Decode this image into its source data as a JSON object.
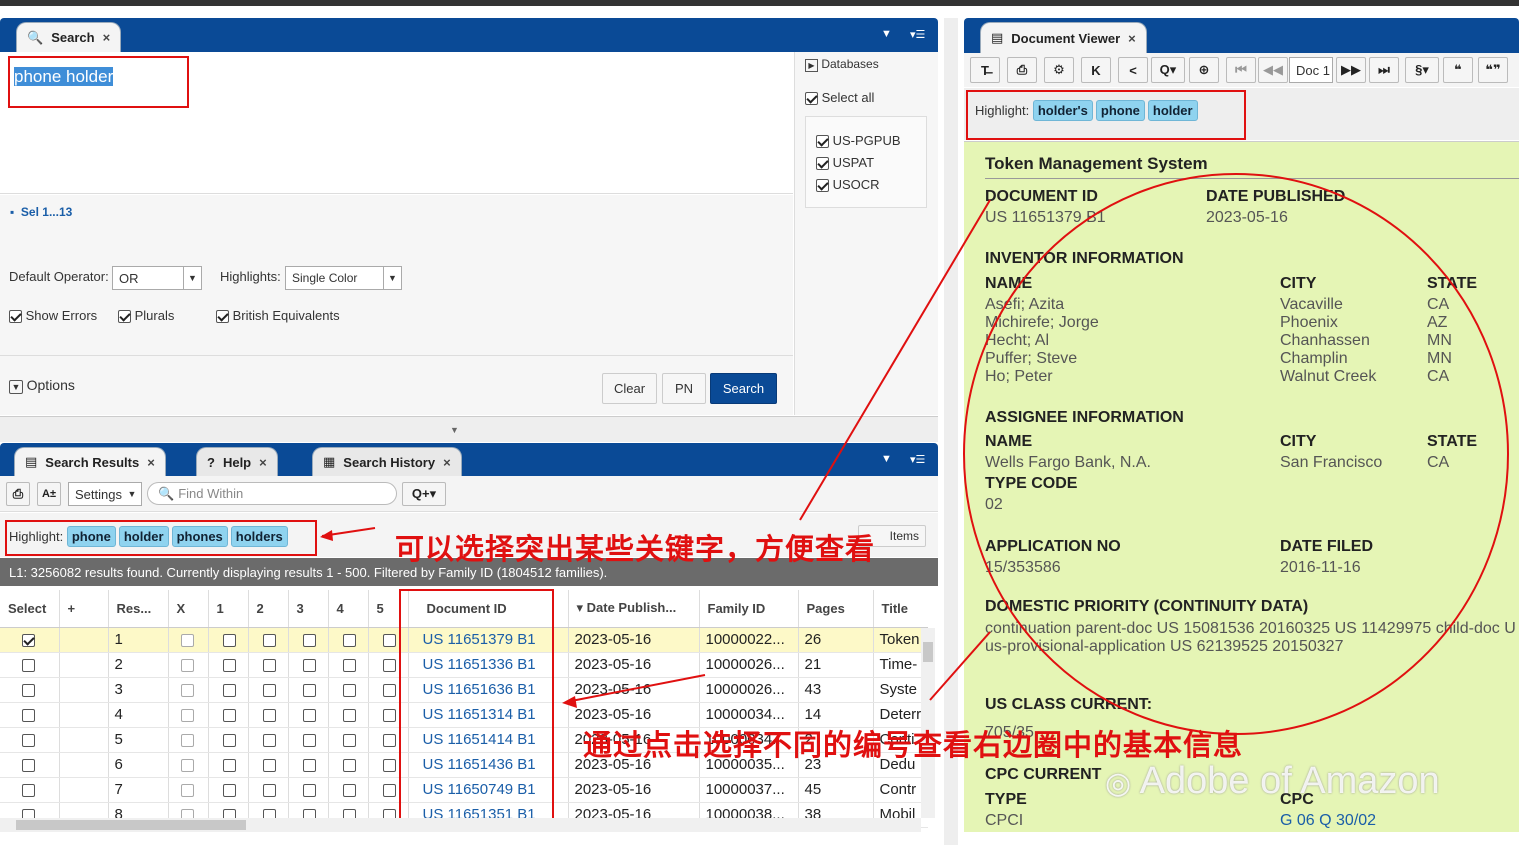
{
  "search_panel": {
    "tab_label": "Search",
    "query": "phone holder",
    "sel_link": "Sel 1...13",
    "default_operator_label": "Default Operator:",
    "default_operator_value": "OR",
    "highlights_label": "Highlights:",
    "highlights_value": "Single Color",
    "show_errors": "Show Errors",
    "plurals": "Plurals",
    "british": "British Equivalents",
    "options": "Options",
    "clear": "Clear",
    "pn": "PN",
    "search": "Search"
  },
  "databases": {
    "title": "Databases",
    "select_all": "Select all",
    "items": [
      "US-PGPUB",
      "USPAT",
      "USOCR"
    ]
  },
  "results_panel": {
    "tabs": [
      "Search Results",
      "Help",
      "Search History"
    ],
    "settings": "Settings",
    "find_within_placeholder": "Find Within",
    "highlight_label": "Highlight:",
    "highlights": [
      "phone",
      "holder",
      "phones",
      "holders"
    ],
    "items_label": "Items",
    "status": "L1: 3256082 results found. Currently displaying results 1 - 500. Filtered by Family ID (1804512 families).",
    "columns": [
      "Select",
      "+",
      "Res...",
      "X",
      "1",
      "2",
      "3",
      "4",
      "5",
      "Document ID",
      "Date Publish...",
      "Family ID",
      "Pages",
      "Title"
    ],
    "rows": [
      {
        "n": "1",
        "doc": "US 11651379 B1",
        "date": "2023-05-16",
        "fam": "10000022...",
        "pages": "26",
        "title": "Token",
        "checked": true
      },
      {
        "n": "2",
        "doc": "US 11651336 B1",
        "date": "2023-05-16",
        "fam": "10000026...",
        "pages": "21",
        "title": "Time-"
      },
      {
        "n": "3",
        "doc": "US 11651636 B1",
        "date": "2023-05-16",
        "fam": "10000026...",
        "pages": "43",
        "title": "Syste"
      },
      {
        "n": "4",
        "doc": "US 11651314 B1",
        "date": "2023-05-16",
        "fam": "10000034...",
        "pages": "14",
        "title": "Deterr"
      },
      {
        "n": "5",
        "doc": "US 11651414 B1",
        "date": "2023-05-16",
        "fam": "10000034...",
        "pages": "2",
        "title": "Conti"
      },
      {
        "n": "6",
        "doc": "US 11651436 B1",
        "date": "2023-05-16",
        "fam": "10000035...",
        "pages": "23",
        "title": "Dedu"
      },
      {
        "n": "7",
        "doc": "US 11650749 B1",
        "date": "2023-05-16",
        "fam": "10000037...",
        "pages": "45",
        "title": "Contr"
      },
      {
        "n": "8",
        "doc": "US 11651351 B1",
        "date": "2023-05-16",
        "fam": "10000038...",
        "pages": "38",
        "title": "Mobil"
      }
    ]
  },
  "viewer": {
    "tab_label": "Document Viewer",
    "doc_label": "Doc 1",
    "highlight_label": "Highlight:",
    "highlights": [
      "holder's",
      "phone",
      "holder"
    ],
    "title": "Token Management System",
    "doc_id_h": "DOCUMENT ID",
    "doc_id": "US 11651379 B1",
    "date_pub_h": "DATE PUBLISHED",
    "date_pub": "2023-05-16",
    "inventor_h": "INVENTOR INFORMATION",
    "name_h": "NAME",
    "city_h": "CITY",
    "state_h": "STATE",
    "inventors": [
      [
        "Asefi; Azita",
        "Vacaville",
        "CA"
      ],
      [
        "Michirefe; Jorge",
        "Phoenix",
        "AZ"
      ],
      [
        "Hecht; Al",
        "Chanhassen",
        "MN"
      ],
      [
        "Puffer; Steve",
        "Champlin",
        "MN"
      ],
      [
        "Ho; Peter",
        "Walnut Creek",
        "CA"
      ]
    ],
    "assignee_h": "ASSIGNEE INFORMATION",
    "assignee": [
      "Wells Fargo Bank, N.A.",
      "San Francisco",
      "CA"
    ],
    "type_code_h": "TYPE CODE",
    "type_code": "02",
    "app_no_h": "APPLICATION NO",
    "app_no": "15/353586",
    "date_filed_h": "DATE FILED",
    "date_filed": "2016-11-16",
    "priority_h": "DOMESTIC PRIORITY (CONTINUITY DATA)",
    "priority_1": "continuation parent-doc US 15081536 20160325 US 11429975 child-doc U",
    "priority_2": "us-provisional-application US 62139525 20150327",
    "us_class_h": "US CLASS CURRENT:",
    "us_class": "705/35",
    "cpc_current_h": "CPC CURRENT",
    "type_h": "TYPE",
    "cpc_h": "CPC",
    "cpc_type": "CPCI",
    "cpc_val": "G 06 Q 30/02"
  },
  "annotations": {
    "a1": "可以选择突出某些关键字，方便查看",
    "a2": "通过点击选择不同的编号查看右边圈中的基本信息",
    "watermark": "Adobe of Amazon"
  },
  "colors": {
    "header_blue": "#0a4a96",
    "highlight_pill": "#8fd3ef",
    "viewer_bg": "#e5f5b5",
    "annotation_red": "#e01010"
  }
}
